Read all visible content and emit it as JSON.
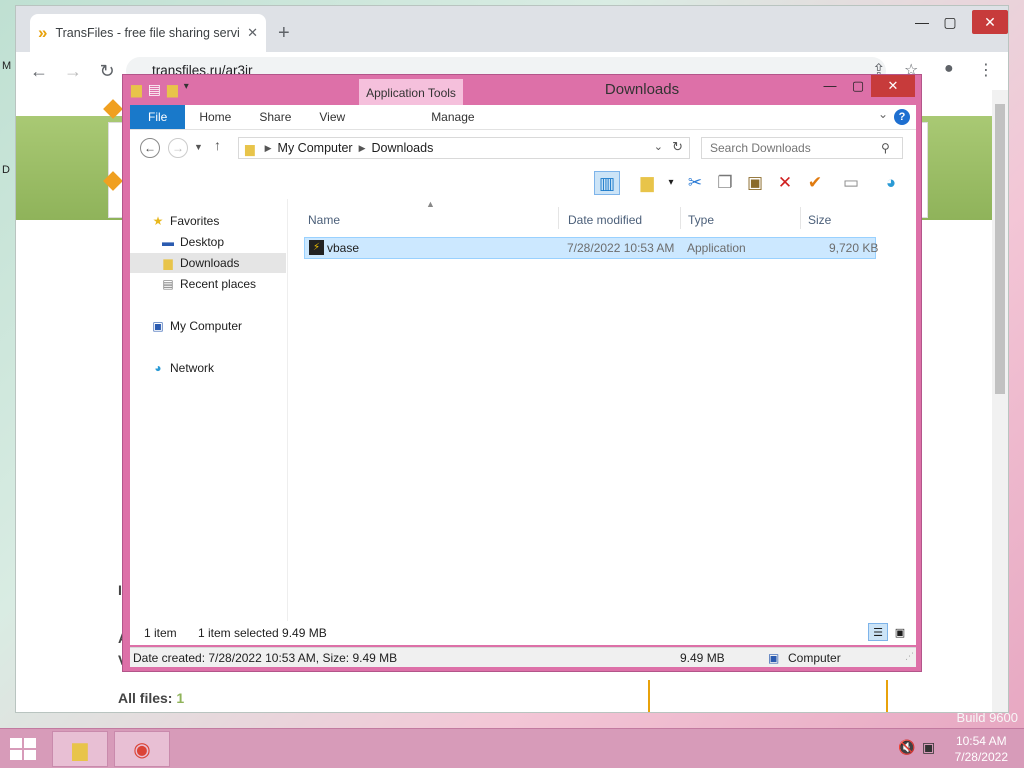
{
  "desktop": {
    "watermark": "Build 9600",
    "edge_left_1": "M",
    "edge_left_2": "D"
  },
  "browser": {
    "tab_title": "TransFiles - free file sharing servi",
    "tab_close": "✕",
    "new_tab": "+",
    "url": "transfiles.ru/ar3ir",
    "page": {
      "all_files_label": "All files:",
      "all_files_count": "1",
      "left_frag_1": "I",
      "left_frag_2": "A",
      "left_frag_3": "V"
    }
  },
  "explorer": {
    "title": "Downloads",
    "app_tools": "Application Tools",
    "ribbon_tabs": [
      "File",
      "Home",
      "Share",
      "View",
      "Manage"
    ],
    "help": "?",
    "address": [
      "My Computer",
      "Downloads"
    ],
    "search_placeholder": "Search Downloads",
    "nav": {
      "favorites": "Favorites",
      "desktop": "Desktop",
      "downloads": "Downloads",
      "recent": "Recent places",
      "computer": "My Computer",
      "network": "Network"
    },
    "columns": [
      "Name",
      "Date modified",
      "Type",
      "Size"
    ],
    "files": [
      {
        "name": "vbase",
        "date": "7/28/2022 10:53 AM",
        "type": "Application",
        "size": "9,720 KB"
      }
    ],
    "status": {
      "items": "1 item",
      "selected": "1 item selected  9.49 MB"
    },
    "details": {
      "info": "Date created: 7/28/2022 10:53 AM, Size: 9.49 MB",
      "size": "9.49 MB",
      "location": "Computer"
    }
  },
  "taskbar": {
    "time": "10:54 AM",
    "date": "7/28/2022"
  },
  "colors": {
    "window_frame": "#dd70a8",
    "file_tab": "#1979ca",
    "selection": "#cce8ff",
    "taskbar": "#d79bb9"
  }
}
